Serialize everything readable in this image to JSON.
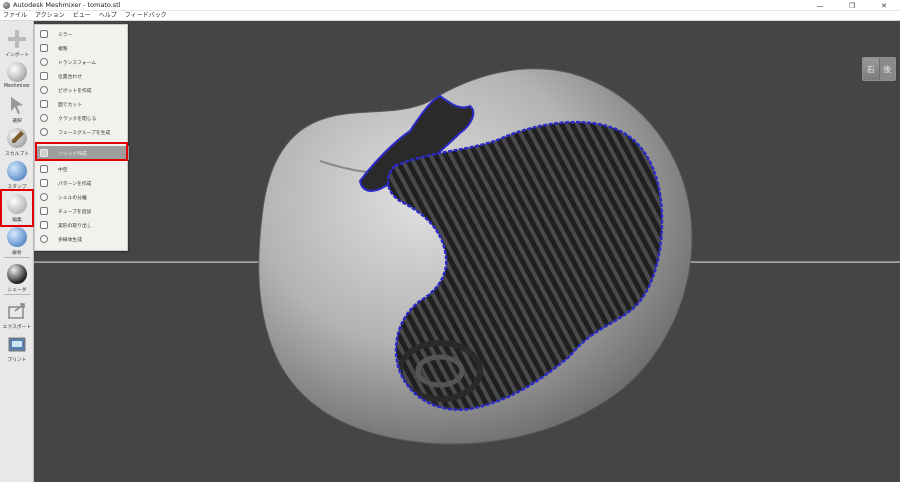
{
  "window": {
    "title": "Autodesk Meshmixer - tomato.stl",
    "minimize": "—",
    "maximize": "❐",
    "close": "✕"
  },
  "menubar": [
    "ファイル",
    "アクション",
    "ビュー",
    "ヘルプ",
    "フィードバック"
  ],
  "toolbar": [
    {
      "id": "import",
      "label": "インポート",
      "icon": "plus-icon"
    },
    {
      "id": "meshmixer",
      "label": "Meshmixer",
      "icon": "sphere-icon"
    },
    {
      "id": "select",
      "label": "選択",
      "icon": "cursor-arrow-icon"
    },
    {
      "id": "sculpt",
      "label": "スカルプト",
      "icon": "brush-icon"
    },
    {
      "id": "stamp",
      "label": "スタンプ",
      "icon": "stamp-icon"
    },
    {
      "id": "edit",
      "label": "編集",
      "icon": "edit-sphere-icon",
      "selected": true
    },
    {
      "id": "analysis",
      "label": "解析",
      "icon": "analysis-sphere-icon"
    },
    {
      "id": "shaders",
      "label": "シェーダ",
      "icon": "shader-sphere-icon"
    },
    {
      "id": "export",
      "label": "エクスポート",
      "icon": "export-icon"
    },
    {
      "id": "print",
      "label": "プリント",
      "icon": "print-icon"
    }
  ],
  "edit_menu": [
    {
      "label": "ミラー",
      "icon": "mirror-icon"
    },
    {
      "label": "複製",
      "icon": "duplicate-icon"
    },
    {
      "label": "トランスフォーム",
      "icon": "transform-icon"
    },
    {
      "label": "位置合わせ",
      "icon": "align-icon"
    },
    {
      "label": "ピボットを作成",
      "icon": "pivot-icon"
    },
    {
      "label": "面でカット",
      "icon": "plane-cut-icon"
    },
    {
      "label": "クラックを閉じる",
      "icon": "close-cracks-icon"
    },
    {
      "label": "フェースグループを生成",
      "icon": "face-groups-icon"
    },
    {
      "label": "ソリッド作成",
      "icon": "make-solid-icon",
      "hover": true
    },
    {
      "label": "中空",
      "icon": "hollow-icon"
    },
    {
      "label": "パターンを作成",
      "icon": "pattern-icon"
    },
    {
      "label": "シェルの分離",
      "icon": "separate-shells-icon"
    },
    {
      "label": "チューブを追加",
      "icon": "add-tube-icon"
    },
    {
      "label": "実形の取り出し",
      "icon": "extract-icon"
    },
    {
      "label": "多様体生成",
      "icon": "manifold-icon"
    }
  ],
  "view_cube": {
    "right": "右",
    "back": "後"
  },
  "colors": {
    "viewport_bg": "#454545",
    "highlight_red": "#e00000",
    "boundary_blue": "#2a2ac8",
    "mesh_gray": "#bdbdbd"
  }
}
